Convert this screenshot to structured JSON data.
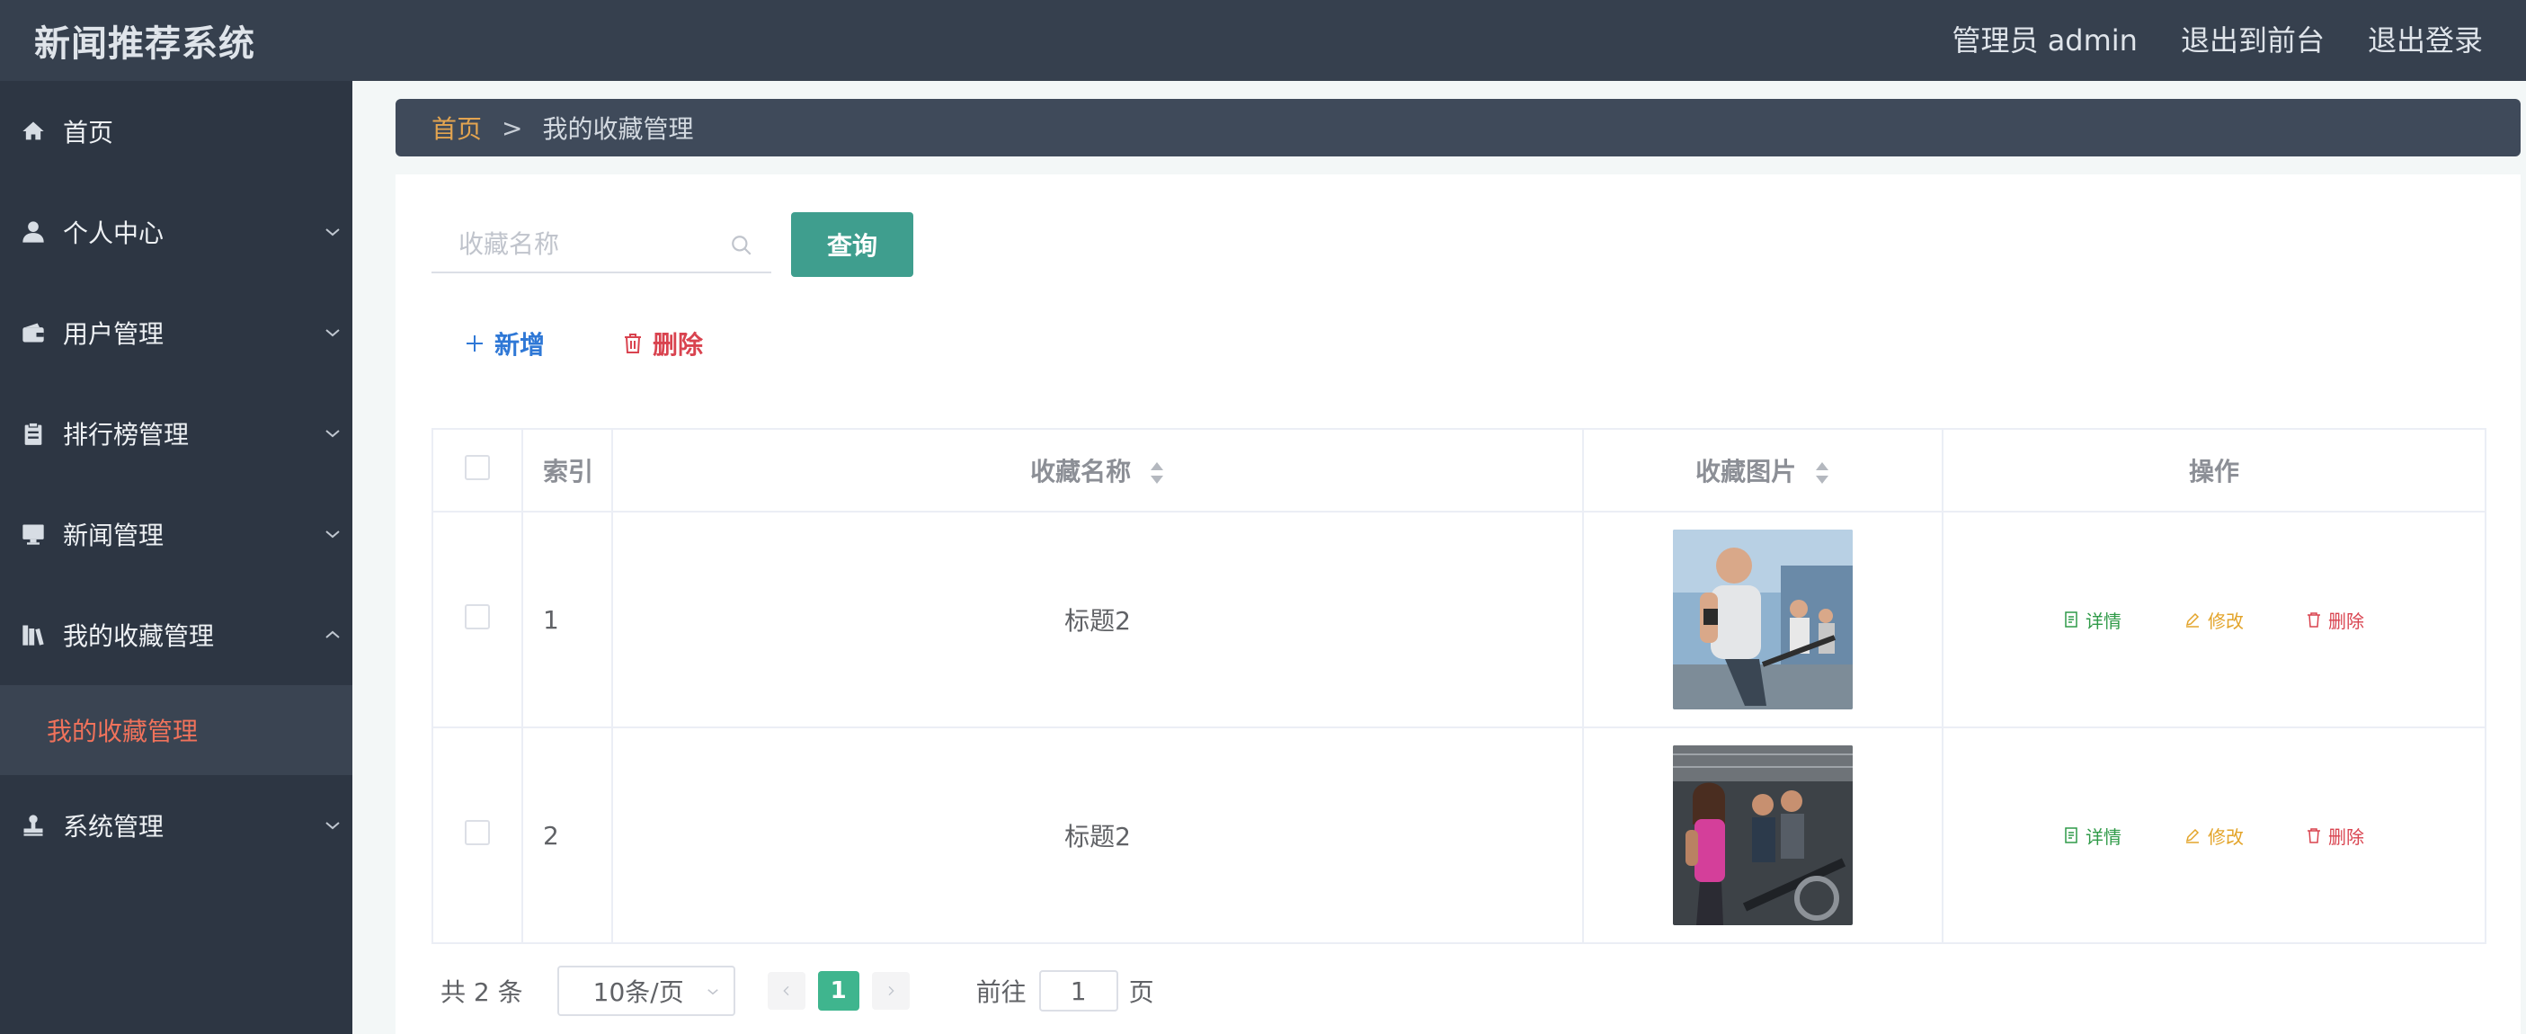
{
  "header": {
    "title": "新闻推荐系统",
    "user_label": "管理员 admin",
    "to_front_label": "退出到前台",
    "logout_label": "退出登录"
  },
  "sidebar": {
    "items": [
      {
        "label": "首页",
        "icon": "home-icon",
        "has_chevron": false
      },
      {
        "label": "个人中心",
        "icon": "user-icon",
        "has_chevron": true
      },
      {
        "label": "用户管理",
        "icon": "wallet-icon",
        "has_chevron": true
      },
      {
        "label": "排行榜管理",
        "icon": "clipboard-icon",
        "has_chevron": true
      },
      {
        "label": "新闻管理",
        "icon": "monitor-icon",
        "has_chevron": true
      },
      {
        "label": "我的收藏管理",
        "icon": "books-icon",
        "has_chevron": true,
        "expanded": true
      },
      {
        "label": "系统管理",
        "icon": "stamp-icon",
        "has_chevron": true
      }
    ],
    "submenu_label": "我的收藏管理"
  },
  "breadcrumb": {
    "home": "首页",
    "separator": ">",
    "current": "我的收藏管理"
  },
  "search": {
    "placeholder": "收藏名称",
    "button_label": "查询"
  },
  "actions": {
    "add_label": "新增",
    "delete_label": "删除"
  },
  "table": {
    "headers": {
      "index": "索引",
      "name": "收藏名称",
      "image": "收藏图片",
      "ops": "操作"
    },
    "rows": [
      {
        "index": "1",
        "name": "标题2",
        "image": "cycling-class-man"
      },
      {
        "index": "2",
        "name": "标题2",
        "image": "cycling-class-woman"
      }
    ],
    "op_labels": {
      "detail": "详情",
      "edit": "修改",
      "delete": "删除"
    }
  },
  "pagination": {
    "total_text": "共 2 条",
    "page_size": "10条/页",
    "current_page": "1",
    "goto_label": "前往",
    "goto_value": "1",
    "page_suffix": "页"
  },
  "colors": {
    "topbar": "#36404e",
    "sidebar": "#2d3643",
    "submenu_active": "#f0725b",
    "breadcrumb_home": "#e3a450",
    "query_button": "#3f9e8e",
    "add": "#2f78d6",
    "delete": "#d9434f",
    "detail": "#2f9a48",
    "edit": "#e3a42a",
    "page_active": "#3fb58e"
  }
}
